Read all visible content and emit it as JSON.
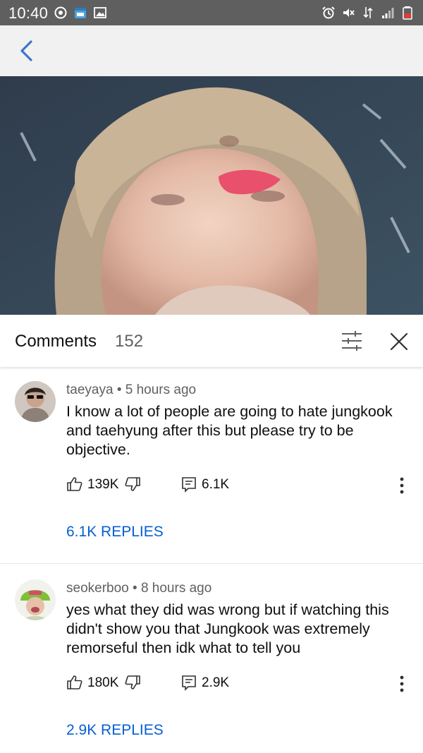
{
  "status_bar": {
    "time": "10:40",
    "left_icons": [
      "sync-icon",
      "calendar-icon",
      "gallery-icon"
    ],
    "right_icons": [
      "alarm-icon",
      "mute-icon",
      "data-icon",
      "signal-icon",
      "battery-icon"
    ]
  },
  "top_bar": {
    "back_icon": "chevron-left-icon",
    "accent": "#065fd4"
  },
  "comments_panel": {
    "title": "Comments",
    "count": "152",
    "filter_icon": "sliders-icon",
    "close_icon": "close-icon"
  },
  "comments": [
    {
      "author": "taeyaya",
      "time": "5 hours ago",
      "text": "I know a lot of people are going to hate jungkook and taehyung after this but please try to be objective.",
      "likes": "139K",
      "replies_count": "6.1K",
      "replies_label": "6.1K REPLIES"
    },
    {
      "author": "seokerboo",
      "time": "8 hours ago",
      "text": "yes what they did was wrong but if watching this didn't show you that Jungkook was extremely remorseful then idk what to tell you",
      "likes": "180K",
      "replies_count": "2.9K",
      "replies_label": "2.9K REPLIES"
    }
  ],
  "meta_separator": "•"
}
